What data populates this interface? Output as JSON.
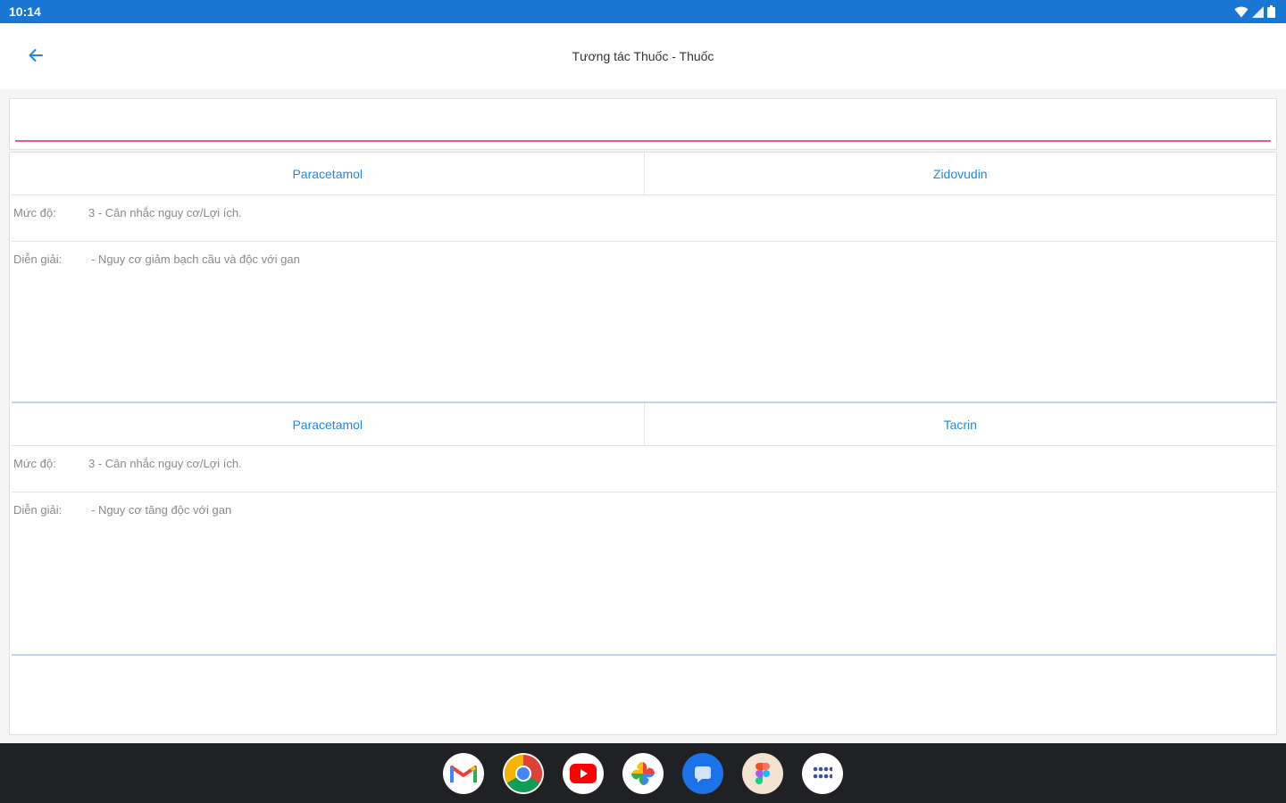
{
  "status_bar": {
    "time": "10:14",
    "icons": [
      "wifi-icon",
      "signal-icon",
      "battery-icon"
    ]
  },
  "app_bar": {
    "back_icon": "arrow-left-icon",
    "title": "Tương tác Thuốc - Thuốc"
  },
  "search": {
    "value": "",
    "placeholder": ""
  },
  "interactions": [
    {
      "drug_a": "Paracetamol",
      "drug_b": "Zidovudin",
      "level_label": "Mức độ:",
      "level_value": "3 - Cân nhắc nguy cơ/Lợi ích.",
      "explain_label": "Diễn giải:",
      "explain_value": "- Nguy cơ giảm bạch cầu và độc với gan"
    },
    {
      "drug_a": "Paracetamol",
      "drug_b": "Tacrin",
      "level_label": "Mức độ:",
      "level_value": "3 - Cân nhắc nguy cơ/Lợi ích.",
      "explain_label": "Diễn giải:",
      "explain_value": "- Nguy cơ tăng độc với gan"
    }
  ],
  "dock": {
    "apps": [
      "gmail-icon",
      "chrome-icon",
      "youtube-icon",
      "photos-icon",
      "messages-icon",
      "figma-icon",
      "app-drawer-icon"
    ]
  },
  "colors": {
    "status_bar": "#1976d2",
    "accent_link": "#1e88e5",
    "input_underline": "#ec5a8a",
    "divider": "#bcd6f4",
    "dock": "#202124"
  }
}
